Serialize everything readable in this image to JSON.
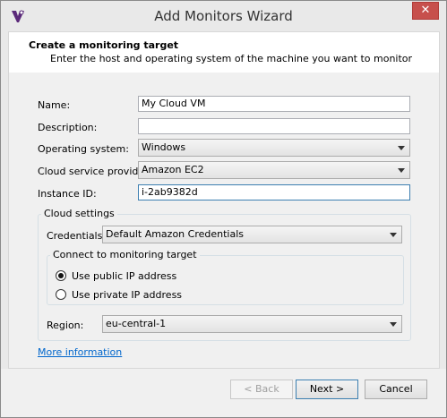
{
  "window": {
    "title": "Add Monitors Wizard",
    "close_glyph": "✕"
  },
  "header": {
    "title": "Create a monitoring target",
    "subtitle": "Enter the host and operating system of the machine you want to monitor"
  },
  "form": {
    "name_label": "Name:",
    "name_value": "My Cloud VM",
    "description_label": "Description:",
    "description_value": "",
    "os_label": "Operating system:",
    "os_value": "Windows",
    "provider_label": "Cloud service provider:",
    "provider_value": "Amazon EC2",
    "instance_label": "Instance ID:",
    "instance_value": "i-2ab9382d"
  },
  "cloud_settings": {
    "title": "Cloud settings",
    "credentials_label": "Credentials:",
    "credentials_value": "Default Amazon Credentials",
    "connect_title": "Connect to monitoring target",
    "public_ip_label": "Use public IP address",
    "private_ip_label": "Use private IP address",
    "selected": "public",
    "region_label": "Region:",
    "region_value": "eu-central-1"
  },
  "more_info_link": "More information",
  "buttons": {
    "back": "< Back",
    "next": "Next >",
    "cancel": "Cancel"
  },
  "colors": {
    "accent": "#3c7fb1",
    "close": "#c7504c",
    "link": "#0066cc"
  },
  "icons": {
    "app": "wizard-app-icon",
    "close": "close-icon",
    "dropdown": "chevron-down-icon"
  }
}
